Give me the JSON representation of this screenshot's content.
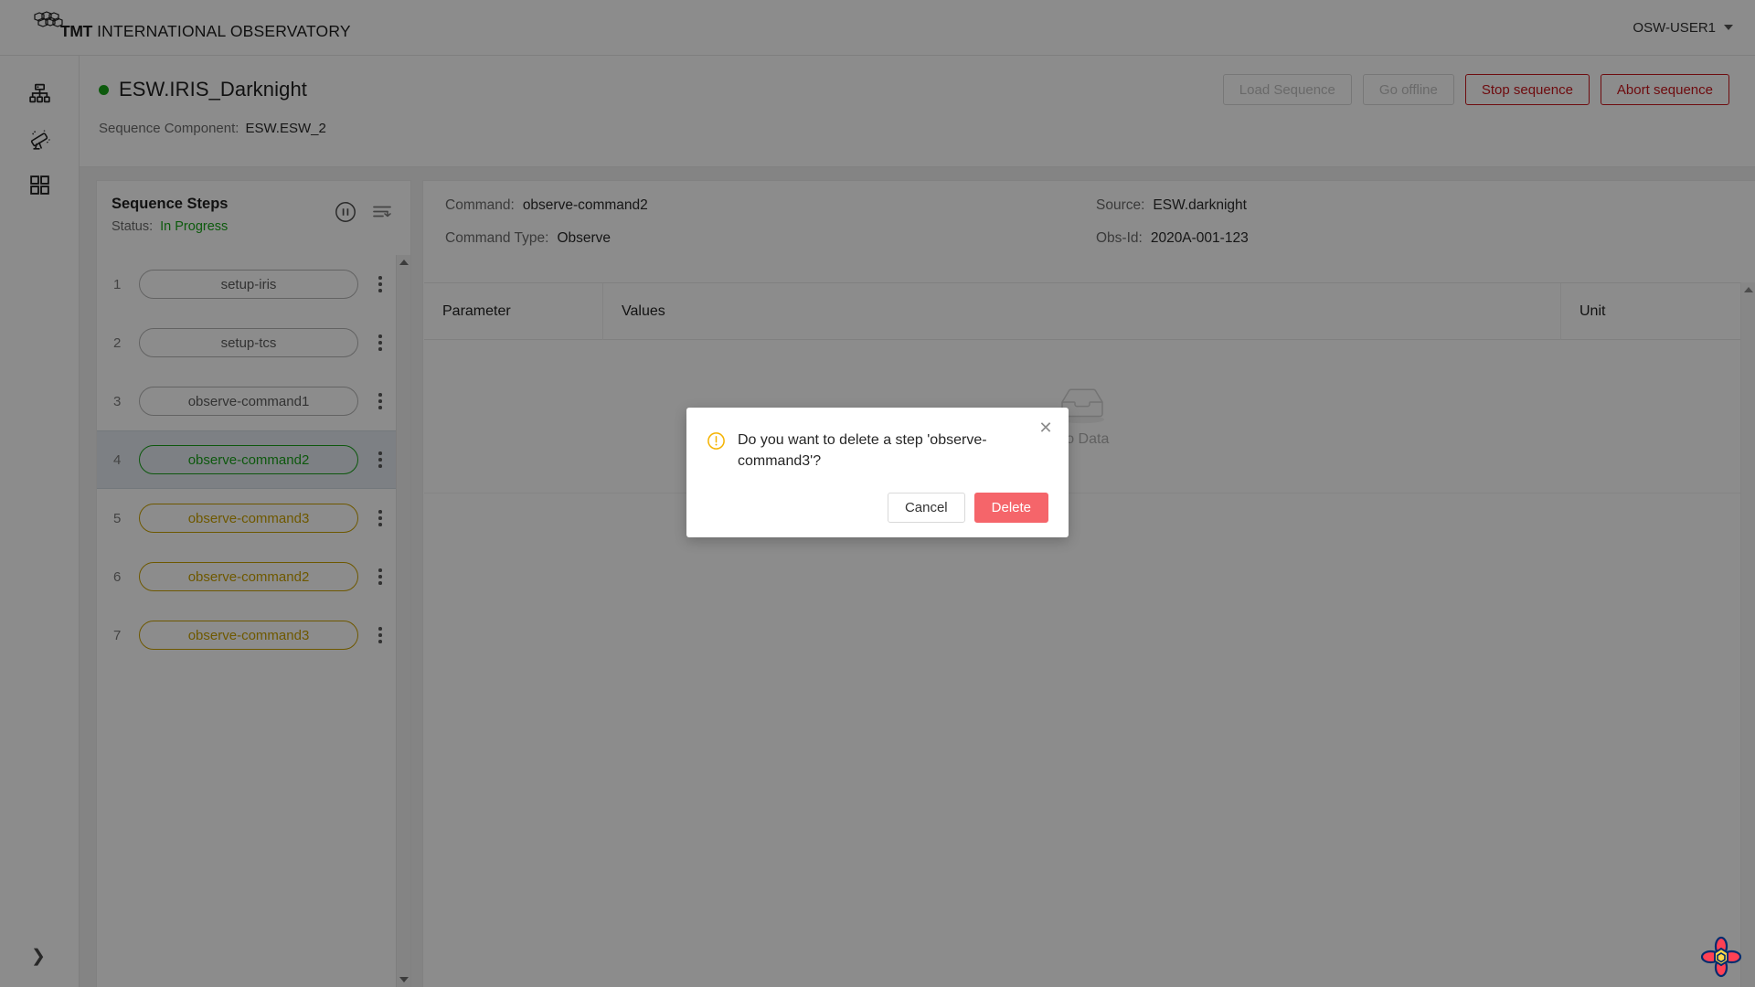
{
  "topbar": {
    "brand_bold": "TMT",
    "brand_rest": " INTERNATIONAL OBSERVATORY",
    "brand_logo_icon": "tmt-mirror-segments-icon",
    "user": "OSW-USER1",
    "user_caret_icon": "chevron-down-icon"
  },
  "rail": {
    "items": [
      {
        "name": "sitemap-icon",
        "label": "Resources"
      },
      {
        "name": "telescope-icon",
        "label": "Observations"
      },
      {
        "name": "grid-apps-icon",
        "label": "Apps"
      }
    ],
    "expand_icon": "chevron-right-icon"
  },
  "page_header": {
    "status_dot_color": "#19a519",
    "title": "ESW.IRIS_Darknight",
    "sequence_component_label": "Sequence Component:",
    "sequence_component_value": "ESW.ESW_2",
    "actions": [
      {
        "label": "Load Sequence",
        "state": "disabled"
      },
      {
        "label": "Go offline",
        "state": "disabled"
      },
      {
        "label": "Stop sequence",
        "state": "danger"
      },
      {
        "label": "Abort sequence",
        "state": "danger"
      }
    ]
  },
  "steps_panel": {
    "title": "Sequence Steps",
    "status_label": "Status:",
    "status_value": "In Progress",
    "status_color": "#19a519",
    "pause_icon": "pause-circle-icon",
    "insert_icon": "insert-breakpoint-icon",
    "steps": [
      {
        "index": "1",
        "label": "setup-iris",
        "state": "pending",
        "selected": false
      },
      {
        "index": "2",
        "label": "setup-tcs",
        "state": "pending",
        "selected": false
      },
      {
        "index": "3",
        "label": "observe-command1",
        "state": "pending",
        "selected": false
      },
      {
        "index": "4",
        "label": "observe-command2",
        "state": "success",
        "selected": true
      },
      {
        "index": "5",
        "label": "observe-command3",
        "state": "queued",
        "selected": false
      },
      {
        "index": "6",
        "label": "observe-command2",
        "state": "queued",
        "selected": false
      },
      {
        "index": "7",
        "label": "observe-command3",
        "state": "queued",
        "selected": false
      }
    ],
    "row_menu_icon": "kebab-menu-icon",
    "scroll_up_icon": "scroll-up-arrow-icon",
    "scroll_down_icon": "scroll-down-arrow-icon"
  },
  "detail": {
    "command_label": "Command:",
    "command_value": "observe-command2",
    "command_type_label": "Command Type:",
    "command_type_value": "Observe",
    "source_label": "Source:",
    "source_value": "ESW.darknight",
    "obsid_label": "Obs-Id:",
    "obsid_value": "2020A-001-123",
    "table": {
      "columns": [
        "Parameter",
        "Values",
        "Unit"
      ],
      "rows": [],
      "empty_text": "No Data",
      "empty_icon": "empty-inbox-icon"
    },
    "scroll_up_icon": "scroll-up-arrow-icon"
  },
  "modal": {
    "icon": "warning-exclamation-icon",
    "icon_color": "#f5b300",
    "message": "Do you want to delete a step 'observe-command3'?",
    "close_icon": "close-x-icon",
    "cancel_label": "Cancel",
    "delete_label": "Delete",
    "delete_color": "#f5656a"
  },
  "devtools": {
    "icon": "react-query-flower-icon"
  }
}
